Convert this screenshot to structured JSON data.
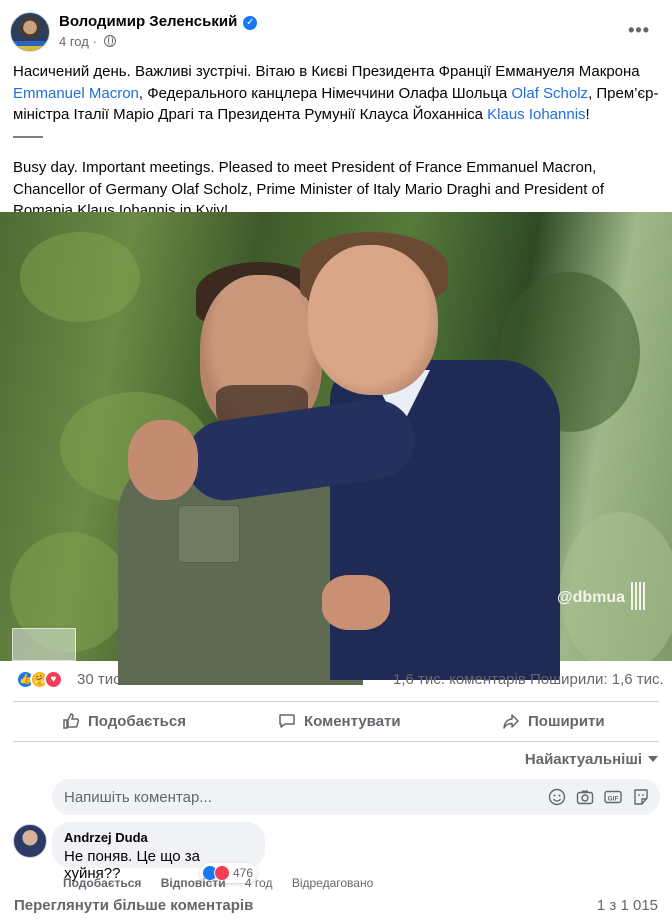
{
  "post": {
    "author": "Володимир Зеленський",
    "time": "4 год",
    "text_ua_1": "Насичений день. Важливі зустрічі. Вітаю в Києві Президента Франції Еммануеля Макрона ",
    "link_macron": "Emmanuel Macron",
    "text_ua_2": ", Федерального канцлера Німеччини Олафа Шольца ",
    "link_scholz": "Olaf Scholz",
    "text_ua_3": ", Прем’єр-міністра Італії Маріо Драгі та Президента Румунії Клауса Йоханніса ",
    "link_iohannis": "Klaus Iohannis",
    "text_ua_4": "!",
    "separator": "——",
    "text_en": "Busy day. Important meetings. Pleased to meet President of France Emmanuel Macron, Chancellor of Germany Olaf Scholz, Prime Minister of Italy Mario Draghi and President of Romania Klaus Iohannis in Kyiv!",
    "watermark": "@dbmua"
  },
  "stats": {
    "reactions": "30 тис.",
    "comments": "1,6 тис. коментарів",
    "shares": "Поширили: 1,6 тис."
  },
  "actions": {
    "like": "Подобається",
    "comment": "Коментувати",
    "share": "Поширити"
  },
  "comments": {
    "sort": "Найактуальніші",
    "placeholder": "Напишіть коментар...",
    "items": [
      {
        "author": "Andrzej Duda",
        "text": "Не поняв. Це що за хуйня??",
        "reactions": "476",
        "like": "Подобається",
        "reply": "Відповісти",
        "time": "4 год",
        "edited": "Відредаговано"
      }
    ],
    "view_more": "Переглянути більше коментарів",
    "pager": "1 з 1 015"
  },
  "colors": {
    "link": "#216fdb",
    "muted": "#65676b",
    "accent": "#1877f2"
  },
  "icons": [
    "verified-icon",
    "globe-icon",
    "more-icon",
    "like-icon",
    "comment-icon",
    "share-icon",
    "emoji-icon",
    "camera-icon",
    "gif-icon",
    "sticker-icon"
  ]
}
